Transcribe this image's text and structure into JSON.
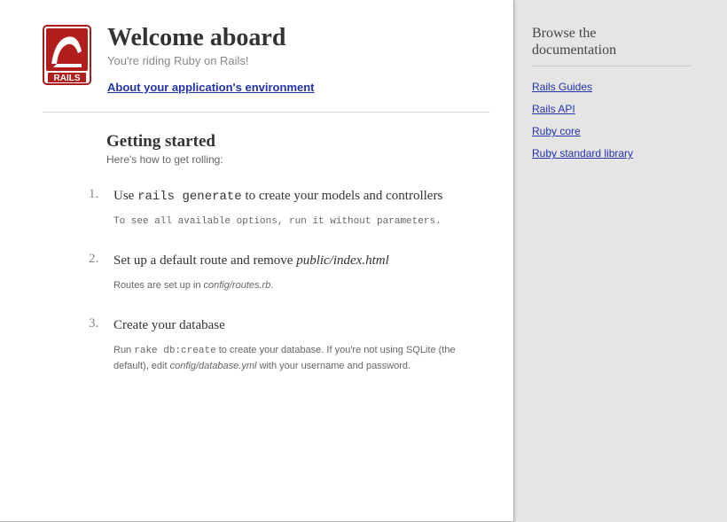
{
  "header": {
    "title": "Welcome aboard",
    "tagline": "You're riding Ruby on Rails!",
    "env_link": "About your application's environment"
  },
  "getting_started": {
    "heading": "Getting started",
    "subtitle": "Here's how to get rolling:"
  },
  "steps": [
    {
      "title_pre": "Use ",
      "title_code": "rails generate",
      "title_post": " to create your models and controllers",
      "note": "To see all available options, run it without parameters."
    },
    {
      "title_pre": "Set up a default route and remove ",
      "title_ital": "public/index.html",
      "note_pre": "Routes are set up in ",
      "note_ital": "config/routes.rb",
      "note_post": "."
    },
    {
      "title": "Create your database",
      "note_pre": "Run ",
      "note_code": "rake db:create",
      "note_mid": " to create your database. If you're not using SQLite (the default), edit ",
      "note_ital": "config/database.yml",
      "note_post": " with your username and password."
    }
  ],
  "sidebar": {
    "heading_l1": "Browse the",
    "heading_l2": "documentation",
    "links": [
      "Rails Guides",
      "Rails API",
      "Ruby core",
      "Ruby standard library"
    ]
  }
}
